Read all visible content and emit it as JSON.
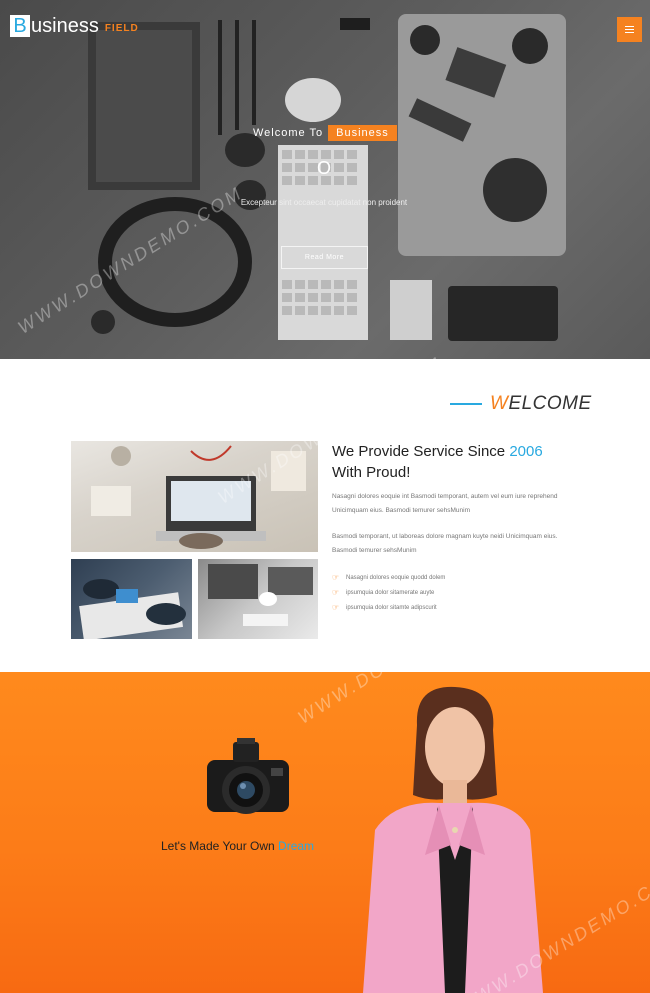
{
  "brand": {
    "initial": "B",
    "name_rest": "usiness",
    "suffix": "FIELD"
  },
  "hero": {
    "welcome_to": "Welcome To",
    "badge": "Business",
    "glyph": "O",
    "subtitle": "Excepteur sint occaecat cupidatat non proident",
    "read_more": "Read More"
  },
  "welcome": {
    "title_first": "W",
    "title_rest": "ELCOME",
    "service_title_line1": "We Provide Service Since",
    "service_year": "2006",
    "service_title_line2": "With Proud!",
    "paragraph1": "Nasagni dolores eoquie int Basmodi temporant, autem vel eum iure reprehend Unicimquam eius. Basmodi temurer sehsMunim",
    "paragraph2": "Basmodi temporant, ut laboreas dolore magnam kuyte neidi Unicimquam eius. Basmodi temurer sehsMunim",
    "list": [
      "Nasagni dolores eoquie quodd dolem",
      "ipsumquia dolor sitamerate auyte",
      "ipsumquia dolor sitamte adipscurit"
    ]
  },
  "banner": {
    "dream_text": "Let's Made Your Own",
    "dream_accent": "Dream"
  },
  "watermark": "WWW.DOWNDEMO.COM",
  "colors": {
    "accent_orange": "#f58220",
    "accent_blue": "#29a9e0"
  }
}
